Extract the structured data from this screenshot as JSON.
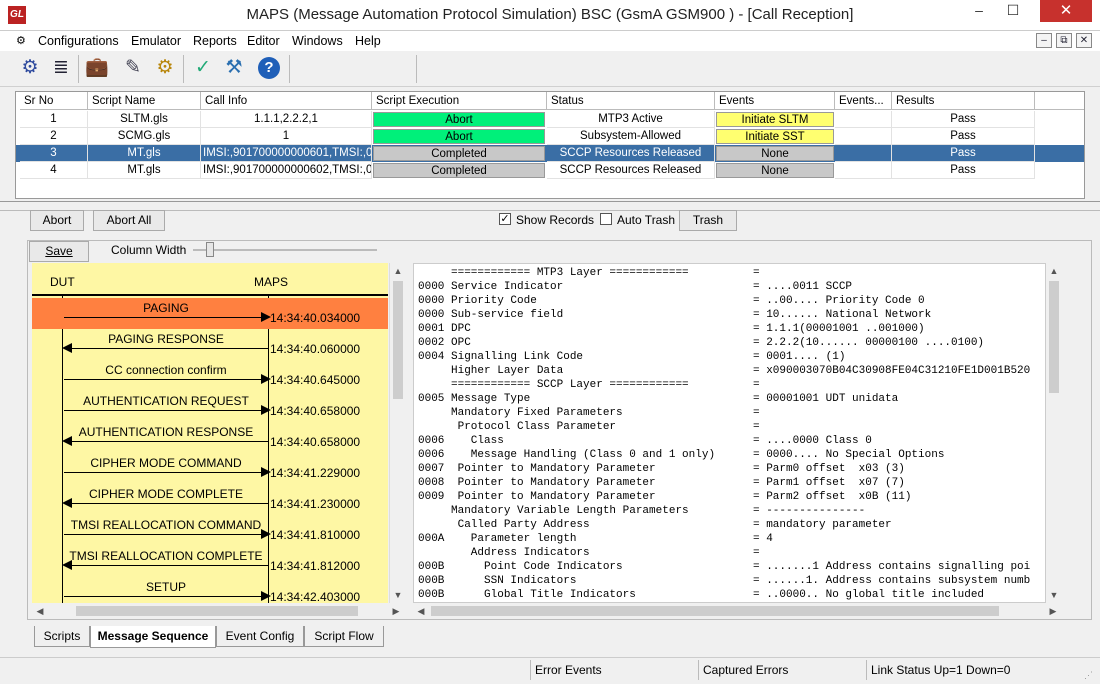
{
  "window": {
    "title": "MAPS (Message Automation Protocol Simulation) BSC (GsmA GSM900 ) - [Call Reception]",
    "app_icon": "GL",
    "minimize": "–",
    "maximize": "☐",
    "close": "✕"
  },
  "menu": [
    "Configurations",
    "Emulator",
    "Reports",
    "Editor",
    "Windows",
    "Help"
  ],
  "mdi": {
    "min": "–",
    "restore": "⧉",
    "close": "✕"
  },
  "toolbar": [
    {
      "name": "configure-gear-icon",
      "glyph": "⚙"
    },
    {
      "name": "script-list-icon",
      "glyph": "≣"
    },
    {
      "name": "briefcase-icon",
      "glyph": "💼"
    },
    {
      "name": "edit-script-icon",
      "glyph": "✎"
    },
    {
      "name": "run-script-icon",
      "glyph": "⚙"
    },
    {
      "name": "checklist-icon",
      "glyph": "✓"
    },
    {
      "name": "user-settings-icon",
      "glyph": "⚒"
    },
    {
      "name": "help-icon",
      "glyph": "?"
    }
  ],
  "grid": {
    "columns": [
      "Sr No",
      "Script Name",
      "Call Info",
      "Script Execution",
      "Status",
      "Events",
      "Events...",
      "Results"
    ],
    "rows": [
      {
        "srno": "1",
        "script": "SLTM.gls",
        "call": "1.1.1,2.2.2,1",
        "exec": "Abort",
        "status": "MTP3 Active",
        "event": "Initiate SLTM",
        "result": "Pass"
      },
      {
        "srno": "2",
        "script": "SCMG.gls",
        "call": "1",
        "exec": "Abort",
        "status": "Subsystem-Allowed",
        "event": "Initiate SST",
        "result": "Pass"
      },
      {
        "srno": "3",
        "script": "MT.gls",
        "call": "IMSI:,901700000000601,TMSI:,0...",
        "exec": "Completed",
        "status": "SCCP Resources Released",
        "event": "None",
        "result": "Pass"
      },
      {
        "srno": "4",
        "script": "MT.gls",
        "call": "IMSI:,901700000000602,TMSI:,0...",
        "exec": "Completed",
        "status": "SCCP Resources Released",
        "event": "None",
        "result": "Pass"
      }
    ]
  },
  "controls": {
    "abort": "Abort",
    "abort_all": "Abort All",
    "show_records": "Show Records",
    "show_records_checked": "✓",
    "auto_trash": "Auto Trash",
    "trash": "Trash",
    "save": "Save",
    "column_width": "Column Width"
  },
  "sequence": {
    "left": "DUT",
    "right": "MAPS",
    "messages": [
      {
        "label": "PAGING",
        "ts": "14:34:40.034000",
        "dir": "r",
        "hl": true
      },
      {
        "label": "PAGING RESPONSE",
        "ts": "14:34:40.060000",
        "dir": "l"
      },
      {
        "label": "CC connection confirm",
        "ts": "14:34:40.645000",
        "dir": "r"
      },
      {
        "label": "AUTHENTICATION REQUEST",
        "ts": "14:34:40.658000",
        "dir": "r"
      },
      {
        "label": "AUTHENTICATION RESPONSE",
        "ts": "14:34:40.658000",
        "dir": "l"
      },
      {
        "label": "CIPHER MODE COMMAND",
        "ts": "14:34:41.229000",
        "dir": "r"
      },
      {
        "label": "CIPHER MODE COMPLETE",
        "ts": "14:34:41.230000",
        "dir": "l"
      },
      {
        "label": "TMSI REALLOCATION COMMAND",
        "ts": "14:34:41.810000",
        "dir": "r"
      },
      {
        "label": "TMSI REALLOCATION COMPLETE",
        "ts": "14:34:41.812000",
        "dir": "l"
      },
      {
        "label": "SETUP",
        "ts": "14:34:42.403000",
        "dir": "r"
      }
    ],
    "highlight": "#ff8040"
  },
  "decode": [
    [
      "     ============ MTP3 Layer ============",
      "="
    ],
    [
      "0000 Service Indicator",
      "= ....0011 SCCP"
    ],
    [
      "0000 Priority Code",
      "= ..00.... Priority Code 0"
    ],
    [
      "0000 Sub-service field",
      "= 10...... National Network"
    ],
    [
      "0001 DPC",
      "= 1.1.1(00001001 ..001000)"
    ],
    [
      "0002 OPC",
      "= 2.2.2(10...... 00000100 ....0100)"
    ],
    [
      "0004 Signalling Link Code",
      "= 0001.... (1)"
    ],
    [
      "     Higher Layer Data",
      "= x090003070B04C30908FE04C31210FE1D001B520"
    ],
    [
      "     ============ SCCP Layer ============",
      "="
    ],
    [
      "0005 Message Type",
      "= 00001001 UDT unidata"
    ],
    [
      "     Mandatory Fixed Parameters",
      "="
    ],
    [
      "      Protocol Class Parameter",
      "="
    ],
    [
      "0006    Class",
      "= ....0000 Class 0"
    ],
    [
      "0006    Message Handling (Class 0 and 1 only)",
      "= 0000.... No Special Options"
    ],
    [
      "0007  Pointer to Mandatory Parameter",
      "= Parm0 offset  x03 (3)"
    ],
    [
      "0008  Pointer to Mandatory Parameter",
      "= Parm1 offset  x07 (7)"
    ],
    [
      "0009  Pointer to Mandatory Parameter",
      "= Parm2 offset  x0B (11)"
    ],
    [
      "     Mandatory Variable Length Parameters",
      "= ---------------"
    ],
    [
      "      Called Party Address",
      "= mandatory parameter"
    ],
    [
      "000A    Parameter length",
      "= 4"
    ],
    [
      "        Address Indicators",
      "="
    ],
    [
      "000B      Point Code Indicators",
      "= .......1 Address contains signalling poi"
    ],
    [
      "000B      SSN Indicators",
      "= ......1. Address contains subsystem numb"
    ],
    [
      "000B      Global Title Indicators",
      "= ..0000.. No global title included"
    ]
  ],
  "tabs": [
    "Scripts",
    "Message Sequence",
    "Event Config",
    "Script Flow"
  ],
  "active_tab": 1,
  "status": {
    "error_events": "Error Events",
    "captured_errors": "Captured Errors",
    "link_status": "Link Status Up=1 Down=0"
  }
}
